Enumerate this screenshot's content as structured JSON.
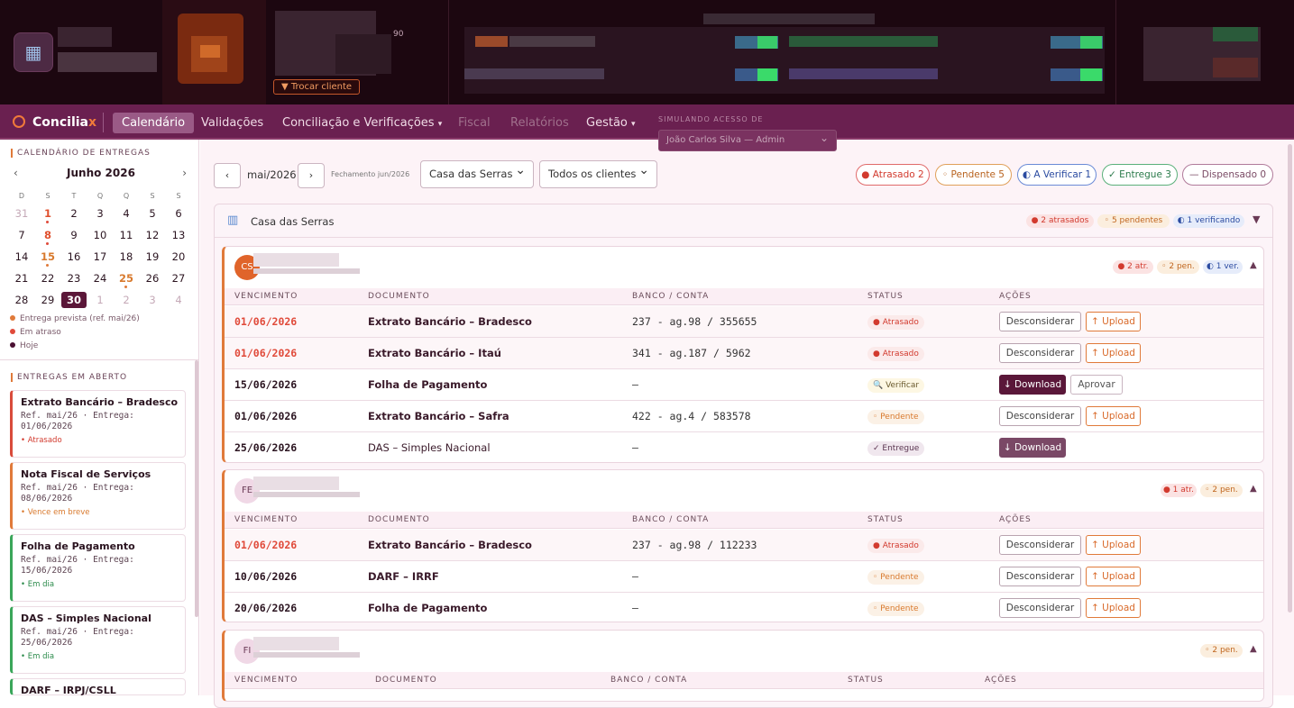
{
  "header": {
    "trocar_cliente": "▼ Trocar cliente",
    "stray_number": "90"
  },
  "nav": {
    "brand_prefix": "Concilia",
    "brand_suffix": "x",
    "items": [
      "Calendário",
      "Validações",
      "Conciliação e Verificações",
      "Fiscal",
      "Relatórios",
      "Gestão"
    ],
    "caret": "▾",
    "simulando_label": "SIMULANDO ACESSO DE",
    "simulando_value": "João Carlos Silva — Admin"
  },
  "sidebar": {
    "calendar_title": "CALENDÁRIO DE ENTREGAS",
    "month": "Junho 2026",
    "prev": "‹",
    "next": "›",
    "weekdays": [
      "D",
      "S",
      "T",
      "Q",
      "Q",
      "S",
      "S"
    ],
    "weeks": [
      [
        "31",
        "1",
        "2",
        "3",
        "4",
        "5",
        "6"
      ],
      [
        "7",
        "8",
        "9",
        "10",
        "11",
        "12",
        "13"
      ],
      [
        "14",
        "15",
        "16",
        "17",
        "18",
        "19",
        "20"
      ],
      [
        "21",
        "22",
        "23",
        "24",
        "25",
        "26",
        "27"
      ],
      [
        "28",
        "29",
        "30",
        "1",
        "2",
        "3",
        "4"
      ]
    ],
    "legend": [
      "Entrega prevista (ref. mai/26)",
      "Em atraso",
      "Hoje"
    ],
    "open_title": "ENTREGAS EM ABERTO",
    "cards": [
      {
        "title": "Extrato Bancário – Bradesco",
        "meta": "Ref. mai/26 · Entrega: 01/06/2026",
        "status": "• Atrasado"
      },
      {
        "title": "Nota Fiscal de Serviços",
        "meta": "Ref. mai/26 · Entrega: 08/06/2026",
        "status": "• Vence em breve"
      },
      {
        "title": "Folha de Pagamento",
        "meta": "Ref. mai/26 · Entrega: 15/06/2026",
        "status": "• Em dia"
      },
      {
        "title": "DAS – Simples Nacional",
        "meta": "Ref. mai/26 · Entrega: 25/06/2026",
        "status": "• Em dia"
      },
      {
        "title": "DARF – IRPJ/CSLL",
        "meta": "",
        "status": ""
      }
    ]
  },
  "toolbar": {
    "prev": "‹",
    "next": "›",
    "month": "mai/2026",
    "fechamento": "Fechamento jun/2026",
    "filter_group": "Casa das Serras",
    "filter_client": "Todos os clientes",
    "chevron": "⌄",
    "pills": [
      "● Atrasado 2",
      "◦ Pendente 5",
      "◐ A Verificar 1",
      "✓ Entregue 3",
      "— Dispensado 0"
    ]
  },
  "group": {
    "name": "Casa das Serras",
    "tags": [
      "● 2 atrasados",
      "◦ 5 pendentes",
      "◐ 1 verificando"
    ],
    "toggle": "▼"
  },
  "table_headers": [
    "VENCIMENTO",
    "DOCUMENTO",
    "BANCO / CONTA",
    "STATUS",
    "AÇÕES"
  ],
  "clients": [
    {
      "initials": "CS",
      "tags": [
        "● 2 atr.",
        "◦ 2 pen.",
        "◐ 1 ver."
      ],
      "toggle": "▲",
      "rows": [
        {
          "date": "01/06/2026",
          "doc": "Extrato Bancário – Bradesco",
          "bank": "237 - ag.98 / 355655",
          "status": "● Atrasado",
          "a1": "Desconsiderar",
          "a2": "↑ Upload"
        },
        {
          "date": "01/06/2026",
          "doc": "Extrato Bancário – Itaú",
          "bank": "341 - ag.187 / 5962",
          "status": "● Atrasado",
          "a1": "Desconsiderar",
          "a2": "↑ Upload"
        },
        {
          "date": "15/06/2026",
          "doc": "Folha de Pagamento",
          "bank": "—",
          "status": "🔍 Verificar",
          "a1": "↓ Download",
          "a2": "Aprovar"
        },
        {
          "date": "01/06/2026",
          "doc": "Extrato Bancário – Safra",
          "bank": "422 - ag.4 / 583578",
          "status": "◦ Pendente",
          "a1": "Desconsiderar",
          "a2": "↑ Upload"
        },
        {
          "date": "25/06/2026",
          "doc": "DAS – Simples Nacional",
          "bank": "—",
          "status": "✓ Entregue",
          "a1": "↓ Download",
          "a2": ""
        }
      ]
    },
    {
      "initials": "FE",
      "tags": [
        "● 1 atr.",
        "◦ 2 pen."
      ],
      "toggle": "▲",
      "rows": [
        {
          "date": "01/06/2026",
          "doc": "Extrato Bancário – Bradesco",
          "bank": "237 - ag.98 / 112233",
          "status": "● Atrasado",
          "a1": "Desconsiderar",
          "a2": "↑ Upload"
        },
        {
          "date": "10/06/2026",
          "doc": "DARF – IRRF",
          "bank": "—",
          "status": "◦ Pendente",
          "a1": "Desconsiderar",
          "a2": "↑ Upload"
        },
        {
          "date": "20/06/2026",
          "doc": "Folha de Pagamento",
          "bank": "—",
          "status": "◦ Pendente",
          "a1": "Desconsiderar",
          "a2": "↑ Upload"
        }
      ]
    },
    {
      "initials": "FI",
      "tags": [
        "◦ 2 pen."
      ],
      "toggle": "▲",
      "rows": []
    }
  ]
}
